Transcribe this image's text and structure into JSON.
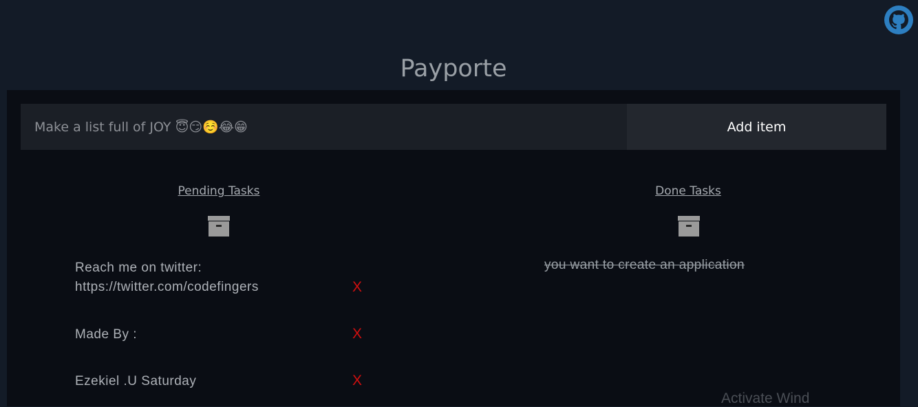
{
  "app": {
    "title": "Payporte"
  },
  "form": {
    "placeholder": "Make a list full of JOY 😇😏☺️😂😁",
    "add_label": "Add item"
  },
  "columns": {
    "pending": {
      "heading": "Pending Tasks",
      "items": [
        {
          "line1": "Reach me on twitter:",
          "line2": "https://twitter.com/codefingers",
          "delete_label": "X"
        },
        {
          "line1": "Made By :",
          "line2": "",
          "delete_label": "X"
        },
        {
          "line1": "Ezekiel .U Saturday",
          "line2": "",
          "delete_label": "X"
        }
      ]
    },
    "done": {
      "heading": "Done Tasks",
      "items": [
        {
          "text": "you want to create an application"
        }
      ]
    }
  },
  "icons": {
    "github": "github-icon",
    "archive": "archive-icon"
  },
  "watermark": "Activate Wind",
  "colors": {
    "background": "#131b27",
    "panel": "#0a0d14",
    "delete": "#d10f0f"
  }
}
